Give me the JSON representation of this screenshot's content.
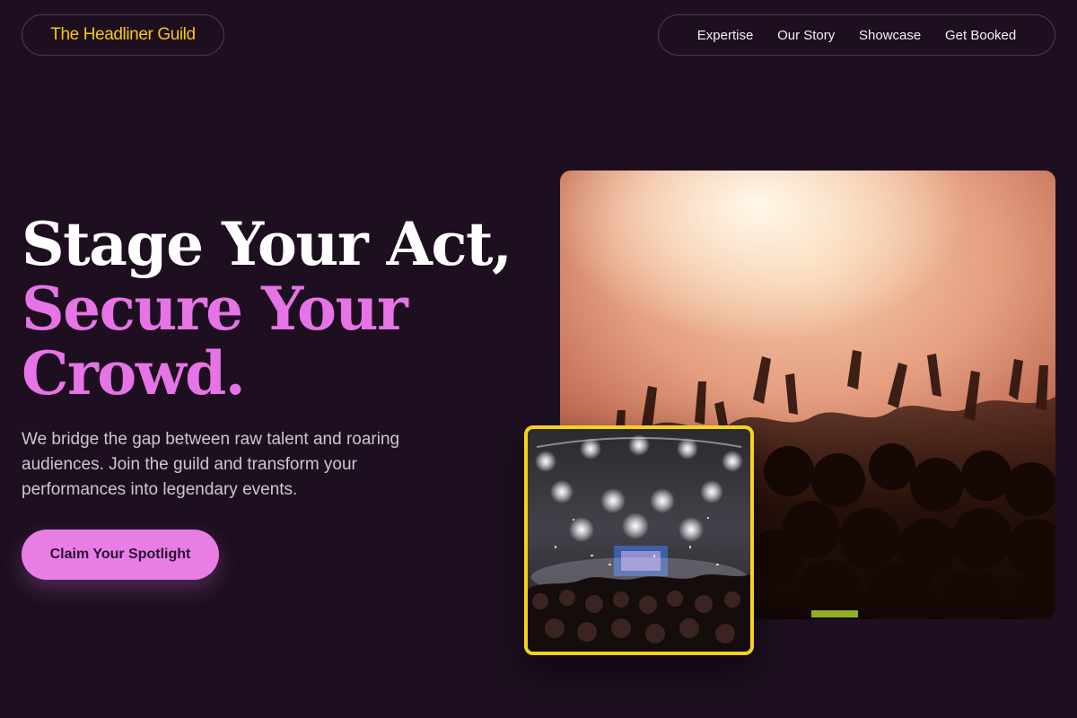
{
  "header": {
    "logo_text": "The Headliner Guild",
    "nav": [
      "Expertise",
      "Our Story",
      "Showcase",
      "Get Booked"
    ]
  },
  "hero": {
    "headline_line1": "Stage Your Act,",
    "headline_line2": "Secure Your",
    "headline_line3": "Crowd.",
    "subtext": "We bridge the gap between raw talent and roaring audiences. Join the guild and transform your performances into legendary events.",
    "cta_label": "Claim Your Spotlight"
  },
  "images": {
    "main_alt": "concert crowd with raised hands under bright stage lights",
    "inset_alt": "festival stage with lights and confetti"
  },
  "colors": {
    "background": "#1d0f1f",
    "accent_pink": "#e774e6",
    "logo_yellow": "#f5c518",
    "inset_border": "#f5d21e"
  }
}
